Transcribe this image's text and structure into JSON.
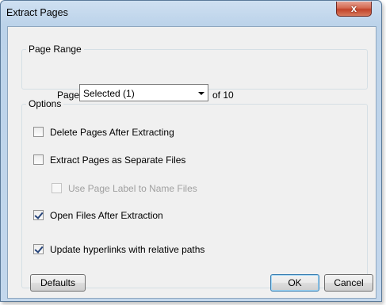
{
  "window": {
    "title": "Extract Pages",
    "close_glyph": "x"
  },
  "page_range": {
    "group_label": "Page Range",
    "pages_label": "Pages",
    "select_value": "Selected (1)",
    "of_label": "of 10"
  },
  "options": {
    "group_label": "Options",
    "items": [
      {
        "label": "Delete Pages After Extracting",
        "checked": false,
        "enabled": true
      },
      {
        "label": "Extract Pages as Separate Files",
        "checked": false,
        "enabled": true
      },
      {
        "label": "Use Page Label to Name Files",
        "checked": false,
        "enabled": false
      },
      {
        "label": "Open Files After Extraction",
        "checked": true,
        "enabled": true
      },
      {
        "label": "Update hyperlinks with relative paths",
        "checked": true,
        "enabled": true
      }
    ]
  },
  "buttons": {
    "defaults": "Defaults",
    "ok": "OK",
    "cancel": "Cancel"
  }
}
